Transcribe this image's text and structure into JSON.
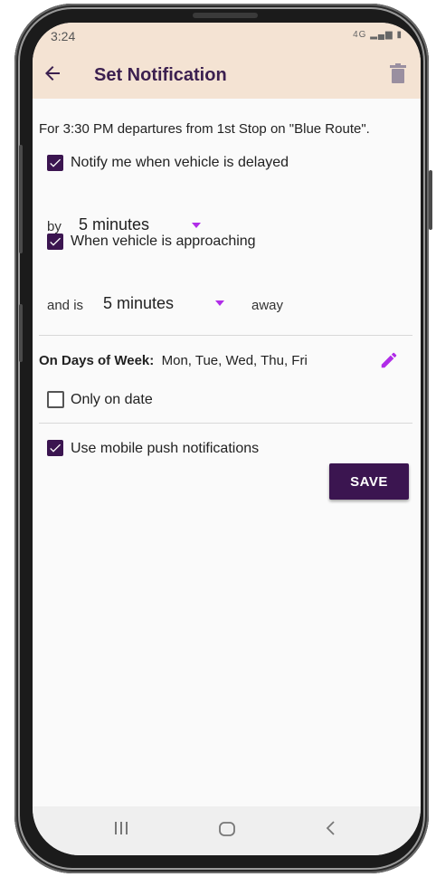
{
  "status": {
    "time": "3:24",
    "icons": "4G"
  },
  "appbar": {
    "title": "Set Notification"
  },
  "description": "For 3:30 PM departures from 1st Stop on \"Blue Route\".",
  "delay": {
    "checked": true,
    "label": "Notify me when vehicle is delayed",
    "by_label": "by",
    "value": "5 minutes"
  },
  "approach": {
    "checked": true,
    "label": "When vehicle is approaching",
    "prefix": "and is",
    "value": "5 minutes",
    "suffix": "away"
  },
  "days": {
    "label": "On Days of Week:",
    "value": "Mon, Tue, Wed, Thu, Fri"
  },
  "only_date": {
    "checked": false,
    "label": "Only on date"
  },
  "push": {
    "checked": true,
    "label": "Use mobile push notifications"
  },
  "save_label": "SAVE",
  "colors": {
    "accent": "#3b1550",
    "header_bg": "#f4e3d3",
    "caret": "#b02ce8"
  }
}
